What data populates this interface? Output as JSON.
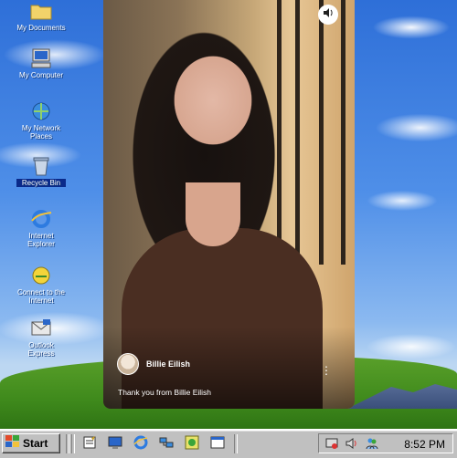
{
  "desktop": {
    "icons": [
      {
        "name": "folder-icon",
        "label": "My Documents"
      },
      {
        "name": "computer-icon",
        "label": "My Computer"
      },
      {
        "name": "network-icon",
        "label": "My Network Places"
      },
      {
        "name": "recycle-bin-icon",
        "label": "Recycle Bin"
      },
      {
        "name": "internet-explorer-icon",
        "label": "Internet Explorer"
      },
      {
        "name": "msn-icon",
        "label": "Connect to the Internet"
      },
      {
        "name": "outlook-icon",
        "label": "Outlook Express"
      }
    ]
  },
  "video_card": {
    "author": "Billie Eilish",
    "caption": "Thank you from Billie Eilish",
    "mute_icon": "speaker-icon",
    "more_icon": "more-vertical-icon"
  },
  "taskbar": {
    "start_label": "Start",
    "clock": "8:52 PM",
    "quick_launch": [
      "notepad-icon",
      "monitor-icon",
      "internet-explorer-icon",
      "network-icon",
      "media-icon",
      "window-icon"
    ],
    "tray": [
      "network-status-icon",
      "volume-icon",
      "users-icon"
    ]
  },
  "colors": {
    "taskbar": "#c0c0c0",
    "sky": "#4f8fe8",
    "grass": "#3f8a1c",
    "shirt": "#4a2e22"
  }
}
